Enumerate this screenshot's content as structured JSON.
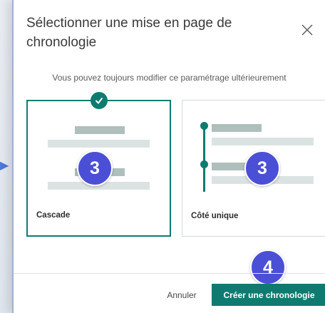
{
  "dialog": {
    "title": "Sélectionner une mise en page de chronologie",
    "close_icon": "close-icon",
    "hint": "Vous pouvez toujours modifier ce paramétrage ultérieurement"
  },
  "layouts": [
    {
      "label": "Cascade",
      "selected": true,
      "selected_icon": "check-icon"
    },
    {
      "label": "Côté unique",
      "selected": false
    }
  ],
  "annotations": {
    "step_3a": "3",
    "step_3b": "3",
    "step_4": "4"
  },
  "footer": {
    "cancel_label": "Annuler",
    "create_label": "Créer une chronologie"
  },
  "colors": {
    "accent": "#0f7b70",
    "step_badge": "#4b4fd6",
    "bar_dark": "#aebfbc",
    "bar_light": "#dbe3e2"
  }
}
